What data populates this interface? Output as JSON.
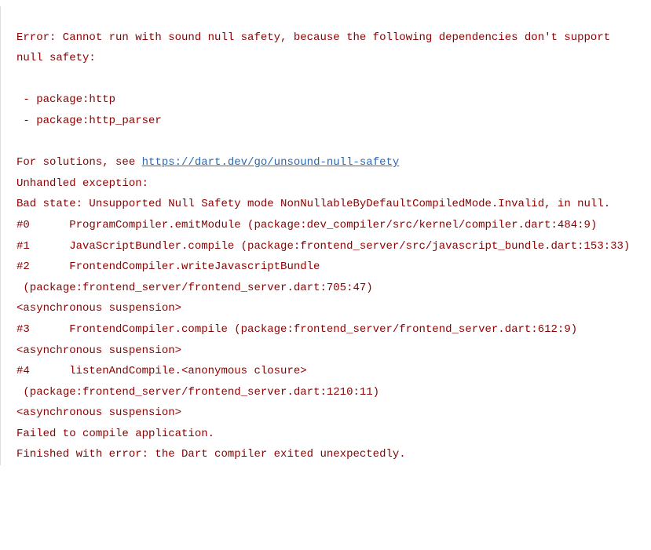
{
  "console": {
    "error_header": "Error: Cannot run with sound null safety, because the following dependencies don't support null safety:",
    "blank1": "",
    "pkg1": " - package:http",
    "pkg2": " - package:http_parser",
    "blank2": "",
    "solutions_prefix": "For solutions, see ",
    "solutions_link": "https://dart.dev/go/unsound-null-safety",
    "unhandled": "Unhandled exception:",
    "badstate": "Bad state: Unsupported Null Safety mode NonNullableByDefaultCompiledMode.Invalid, in null.",
    "trace0": "#0      ProgramCompiler.emitModule (package:dev_compiler/src/kernel/compiler.dart:484:9)",
    "trace1": "#1      JavaScriptBundler.compile (package:frontend_server/src/javascript_bundle.dart:153:33)",
    "trace2a": "#2      FrontendCompiler.writeJavascriptBundle",
    "trace2b": " (package:frontend_server/frontend_server.dart:705:47)",
    "async1": "<asynchronous suspension>",
    "trace3": "#3      FrontendCompiler.compile (package:frontend_server/frontend_server.dart:612:9)",
    "async2": "<asynchronous suspension>",
    "trace4a": "#4      listenAndCompile.<anonymous closure>",
    "trace4b": " (package:frontend_server/frontend_server.dart:1210:11)",
    "async3": "<asynchronous suspension>",
    "failed": "Failed to compile application.",
    "finished": "Finished with error: the Dart compiler exited unexpectedly."
  }
}
